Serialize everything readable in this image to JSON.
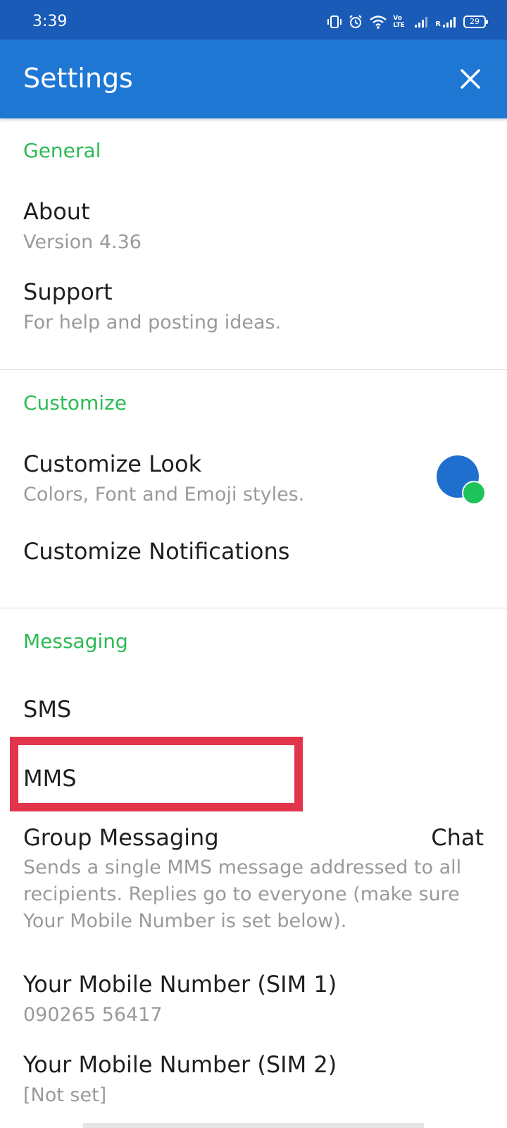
{
  "status_bar": {
    "time": "3:39",
    "battery": "29",
    "icons": [
      "vibrate-icon",
      "alarm-icon",
      "wifi-icon",
      "volte-icon",
      "signal-icon",
      "roaming-signal-icon",
      "battery-icon"
    ],
    "volte_text": "Vo LTE",
    "roaming_text": "R"
  },
  "app_bar": {
    "title": "Settings",
    "close_icon": "close-icon",
    "color": "#1f77d4"
  },
  "sections": {
    "general": {
      "header": "General",
      "about": {
        "title": "About",
        "subtitle": "Version 4.36"
      },
      "support": {
        "title": "Support",
        "subtitle": "For help and posting ideas."
      }
    },
    "customize": {
      "header": "Customize",
      "look": {
        "title": "Customize Look",
        "subtitle": "Colors, Font and Emoji styles."
      },
      "notifications": {
        "title": "Customize Notifications"
      }
    },
    "messaging": {
      "header": "Messaging",
      "sms": {
        "title": "SMS"
      },
      "mms": {
        "title": "MMS"
      },
      "group": {
        "title": "Group Messaging",
        "value": "Chat",
        "description": "Sends a single MMS message addressed to all recipients. Replies go to everyone (make sure Your Mobile Number is set below)."
      },
      "sim1": {
        "title": "Your Mobile Number (SIM 1)",
        "subtitle": "090265 56417"
      },
      "sim2": {
        "title": "Your Mobile Number (SIM 2)",
        "subtitle": "[Not set]"
      }
    }
  },
  "colors": {
    "section_header": "#2dbb54",
    "highlight": "#e2354b",
    "status_bar": "#1a5bb8"
  }
}
